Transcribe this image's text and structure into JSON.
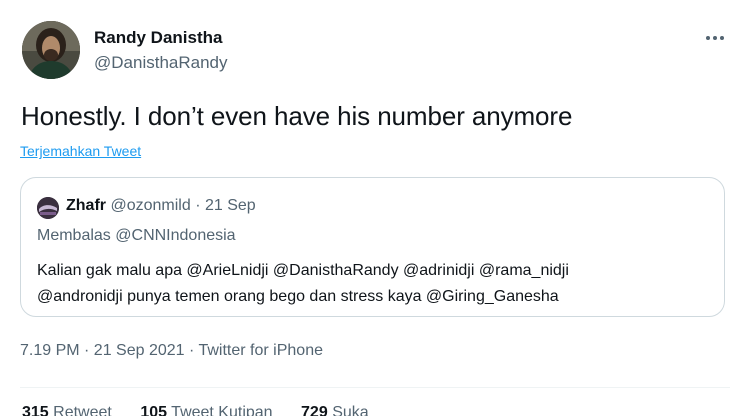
{
  "author": {
    "name": "Randy Danistha",
    "handle": "@DanisthaRandy",
    "avatar_icon": "profile-photo"
  },
  "more_icon": "ellipsis-icon",
  "tweet_text": "Honestly. I don’t even have his number anymore",
  "translate_link": "Terjemahkan Tweet",
  "quote": {
    "name": "Zhafr",
    "handle": "@ozonmild",
    "separator": "·",
    "date": "21 Sep",
    "reply_prefix": "Membalas",
    "reply_to": "@CNNIndonesia",
    "line1": "Kalian gak malu apa @ArieLnidji @DanisthaRandy @adrinidji @rama_nidji",
    "line2": "@andronidji punya temen orang bego dan stress kaya @Giring_Ganesha"
  },
  "timestamp": "7.19 PM · 21 Sep 2021 · Twitter for iPhone",
  "stats": {
    "retweets_count": "315",
    "retweets_label": "Retweet",
    "quotes_count": "105",
    "quotes_label": "Tweet Kutipan",
    "likes_count": "729",
    "likes_label": "Suka"
  },
  "colors": {
    "link": "#1d9bf0",
    "secondary_text": "#536471",
    "border": "#cfd9de"
  }
}
